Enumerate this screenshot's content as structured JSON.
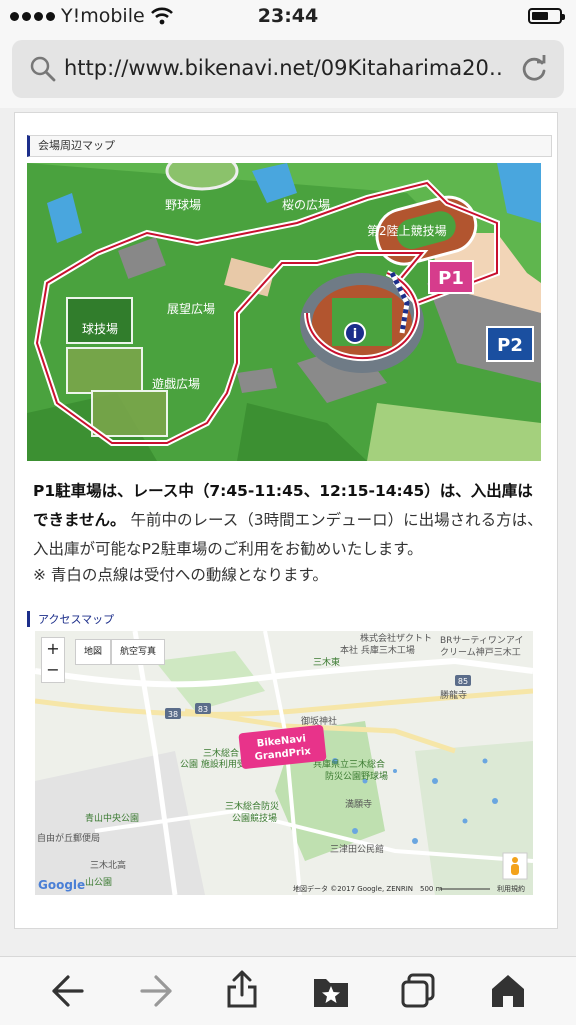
{
  "status_bar": {
    "carrier": "Y!mobile",
    "time": "23:44",
    "battery_level": 0.6
  },
  "browser": {
    "url": "http://www.bikenavi.net/09Kitaharima20…"
  },
  "venue_map": {
    "heading": "会場周辺マップ",
    "labels": {
      "baseball": "野球場",
      "sakura": "桜の広場",
      "stadium2": "第2陸上競技場",
      "view": "展望広場",
      "ballfield": "球技場",
      "play": "遊戯広場",
      "p1": "P1",
      "p2": "P2",
      "info": "i"
    }
  },
  "notice": {
    "bold": "P1駐車場は、レース中（7:45-11:45、12:15-14:45）は、入出庫はできません。",
    "rest": "午前中のレース（3時間エンデューロ）に出場される方は、入出庫が可能なP2駐車場のご利用をお勧めいたします。",
    "note": "※ 青白の点線は受付への動線となります。"
  },
  "access_map": {
    "heading": "アクセスマップ",
    "zoom_in": "+",
    "zoom_out": "−",
    "map_type_map": "地図",
    "map_type_satellite": "航空写真",
    "labels": {
      "company": "株式会社ザクトト",
      "company2": "本社 兵庫三木工場",
      "br1": "BRサーティワンアイ",
      "br2": "クリーム神戸三木工",
      "road": "三木東",
      "temple1": "勝龍寺",
      "shrine": "御坂神社",
      "park1": "三木総合",
      "park2": "公園 施設利用受付",
      "bb1": "兵庫県立三木総合",
      "bb2": "防災公園野球場",
      "temple2": "満願寺",
      "stadium1": "三木総合防災",
      "stadium2": "公園競技場",
      "aoyama": "青山中央公園",
      "jiyu": "自由が丘郵便局",
      "school": "三木北高",
      "yama": "山公園",
      "hall": "三津田公民館",
      "road38": "38",
      "road83": "83",
      "road85": "85",
      "copyright": "地図データ ©2017 Google, ZENRIN",
      "scale": "500 m",
      "terms": "利用規約",
      "google": "Google",
      "banner1": "BikeNavi",
      "banner2": "GrandPrix"
    }
  },
  "toolbar": {
    "icons": [
      "back-icon",
      "forward-icon",
      "share-icon",
      "bookmarks-icon",
      "tabs-icon",
      "home-icon"
    ]
  },
  "colors": {
    "accent": "#1c2e8a",
    "p1": "#d63c8c",
    "p2": "#1a4fa0",
    "course": "#c8102e",
    "grass": "#5cb84a"
  }
}
